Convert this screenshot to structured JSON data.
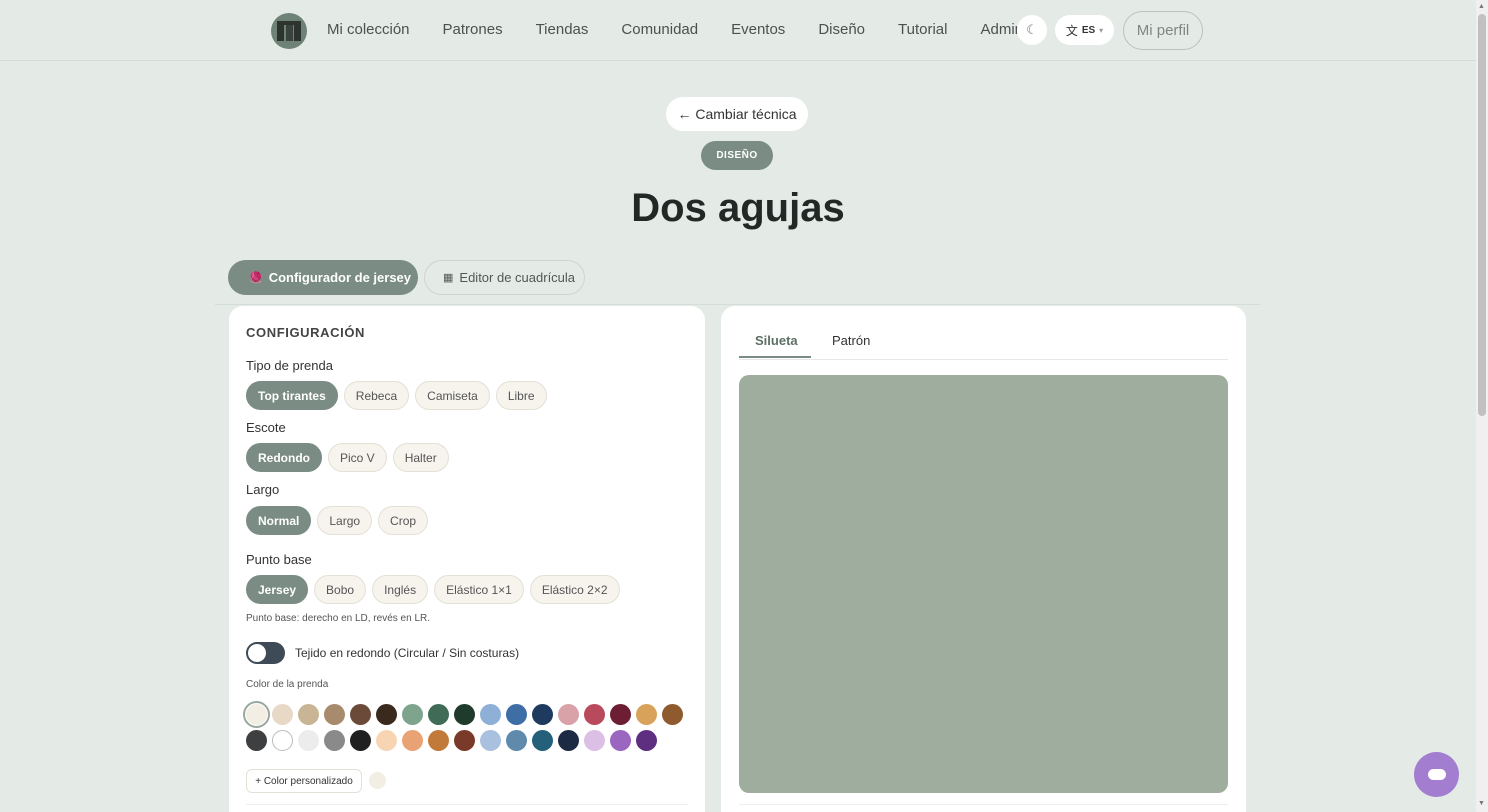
{
  "nav": {
    "links": [
      "Mi colección",
      "Patrones",
      "Tiendas",
      "Comunidad",
      "Eventos",
      "Diseño",
      "Tutorial",
      "Admin"
    ],
    "theme_icon": "☾",
    "lang_icon": "文",
    "lang_code": "ES",
    "lang_caret": "▾",
    "profile": "Mi perfil"
  },
  "hero": {
    "back": "← Cambiar técnica",
    "badge": "DISEÑO",
    "title": "Dos agujas"
  },
  "modes": {
    "configurator": "Configurador de jersey",
    "grid_editor": "Editor de cuadrícula",
    "configurator_icon": "🧶",
    "grid_icon": "▦"
  },
  "config": {
    "heading": "CONFIGURACIÓN",
    "garment": {
      "label": "Tipo de prenda",
      "options": [
        "Top tirantes",
        "Rebeca",
        "Camiseta",
        "Libre"
      ],
      "selected": "Top tirantes"
    },
    "neckline": {
      "label": "Escote",
      "options": [
        "Redondo",
        "Pico V",
        "Halter"
      ],
      "selected": "Redondo"
    },
    "length": {
      "label": "Largo",
      "options": [
        "Normal",
        "Largo",
        "Crop"
      ],
      "selected": "Normal"
    },
    "stitch": {
      "label": "Punto base",
      "options": [
        "Jersey",
        "Bobo",
        "Inglés",
        "Elástico 1×1",
        "Elástico 2×2"
      ],
      "selected": "Jersey"
    },
    "stitch_hint": "Punto base: derecho en LD, revés en LR.",
    "round_toggle": {
      "label": "Tejido en redondo (Circular / Sin costuras)",
      "on": false
    },
    "color_label": "Color de la prenda",
    "colors_row1": [
      "#f3eee4",
      "#e8d8c6",
      "#c9b595",
      "#a88a6c",
      "#6b4a3a",
      "#3a2a1e",
      "#7fa48e",
      "#3f6b57",
      "#1f3b2c",
      "#8fb0d6",
      "#3f6ea6",
      "#1e3a5e",
      "#d9a1a8",
      "#b84a5c",
      "#6e1e34",
      "#d9a25a",
      "#8e5a2e"
    ],
    "colors_row2": [
      "#3d3f40",
      "#ffffff",
      "#ececec",
      "#8a8a8a",
      "#202020",
      "#f7d5b3",
      "#e9a274",
      "#c27a3a",
      "#7a3a2a",
      "#a9c1df",
      "#5f8aac",
      "#24607a",
      "#1c2a44",
      "#dcbfe5",
      "#9a66c0",
      "#5e2f80"
    ],
    "selected_color": "#f3eee4",
    "custom_button": "+ Color personalizado"
  },
  "preview": {
    "tabs": [
      "Silueta",
      "Patrón"
    ],
    "active_tab": "Silueta",
    "canvas_color": "#9fad9f"
  },
  "colors": {
    "accent": "#7a8c83",
    "background": "#e4ebe7",
    "fab": "#a37dd0"
  }
}
